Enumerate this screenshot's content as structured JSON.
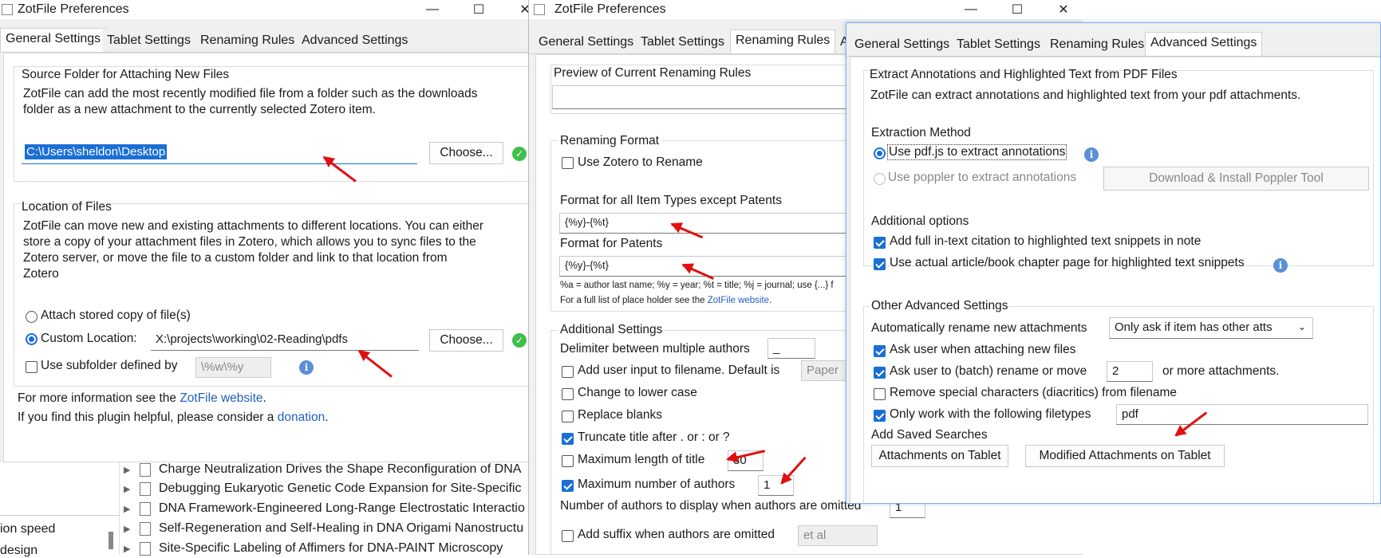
{
  "w1": {
    "title": "ZotFile Preferences",
    "tabs": [
      "General Settings",
      "Tablet Settings",
      "Renaming Rules",
      "Advanced Settings"
    ],
    "source_title": "Source Folder for Attaching New Files",
    "source_desc_1": "ZotFile can add the most recently modified file from a folder such as the downloads",
    "source_desc_2": "folder as a new attachment to the currently selected Zotero item.",
    "source_path": "C:\\Users\\sheldon\\Desktop",
    "choose": "Choose...",
    "loc_title": "Location of Files",
    "loc_desc_1": "ZotFile can move new and existing attachments to different locations. You can either",
    "loc_desc_2": "store a copy of your attachment files in Zotero, which allows you to sync files to the",
    "loc_desc_3": "Zotero server, or move the file to a custom folder and link to that location from",
    "loc_desc_4": "Zotero",
    "attach_stored": "Attach stored copy of file(s)",
    "custom_location": "Custom Location:",
    "custom_path": "X:\\projects\\working\\02-Reading\\pdfs",
    "use_subfolder": "Use subfolder defined by",
    "subfolder_value": "\\%w\\%y",
    "more_info": "For more information see the ",
    "website": "ZotFile website",
    "period": ".",
    "helpful": "If you find this plugin helpful, please consider a ",
    "donation": "donation"
  },
  "bg": {
    "rows": [
      "Charge Neutralization Drives the Shape Reconfiguration of DNA",
      "Debugging Eukaryotic Genetic Code Expansion for Site-Specific",
      "DNA Framework-Engineered Long-Range Electrostatic Interactio",
      "Self-Regeneration and Self-Healing in DNA Origami Nanostructu",
      "Site-Specific Labeling of Affimers for DNA-PAINT Microscopy"
    ],
    "side_1": "ion speed",
    "side_2": "design"
  },
  "w2": {
    "title": "ZotFile Preferences",
    "tabs": [
      "General Settings",
      "Tablet Settings",
      "Renaming Rules",
      "A"
    ],
    "preview": "Preview of Current Renaming Rules",
    "renaming_format": "Renaming Format",
    "use_zotero": "Use Zotero to Rename",
    "format_all": "Format for all Item Types except Patents",
    "format_all_value": "{%y}-{%t}",
    "format_patents": "Format for Patents",
    "format_patents_value": "{%y}-{%t}",
    "legend": "%a = author last name; %y = year; %t = title; %j = journal; use {...} f",
    "full_list": "For a full list of place holder see the ",
    "website": "ZotFile website",
    "period": ".",
    "additional": "Additional Settings",
    "delimiter": "Delimiter between multiple authors",
    "delimiter_value": "_",
    "add_user_input": "Add user input to filename. Default is",
    "default_value": "Paper",
    "lower_case": "Change to lower case",
    "replace_blanks": "Replace blanks",
    "truncate": "Truncate title after . or : or ?",
    "max_length": "Maximum length of title",
    "max_length_value": "80",
    "max_authors": "Maximum number of authors",
    "max_authors_value": "1",
    "num_display": "Number of authors to display when authors are omitted",
    "num_display_value": "1",
    "add_suffix": "Add suffix when authors are omitted",
    "suffix_value": "et al"
  },
  "w3": {
    "tabs": [
      "General Settings",
      "Tablet Settings",
      "Renaming Rules",
      "Advanced Settings"
    ],
    "extract_title": "Extract Annotations and Highlighted Text from PDF Files",
    "extract_desc": "ZotFile can extract annotations and highlighted text from your pdf attachments.",
    "method": "Extraction Method",
    "pdfjs": "Use pdf.js to extract annotations",
    "poppler": "Use poppler to extract annotations",
    "download_poppler": "Download & Install Poppler Tool",
    "additional_options": "Additional options",
    "full_citation": "Add full in-text citation to highlighted text snippets in note",
    "actual_page": "Use actual article/book chapter page for highlighted text snippets",
    "other": "Other Advanced Settings",
    "auto_rename": "Automatically rename new attachments",
    "auto_rename_value": "Only ask if item has other atts",
    "ask_attach": "Ask user when attaching new files",
    "ask_batch": "Ask user to (batch) rename or move",
    "batch_value": "2",
    "or_more": "or more attachments.",
    "remove_special": "Remove special characters (diacritics) from filename",
    "only_filetypes": "Only work with the following filetypes",
    "filetypes_value": "pdf",
    "saved_searches": "Add Saved Searches",
    "att_tablet": "Attachments on Tablet",
    "mod_att_tablet": "Modified Attachments on Tablet"
  }
}
